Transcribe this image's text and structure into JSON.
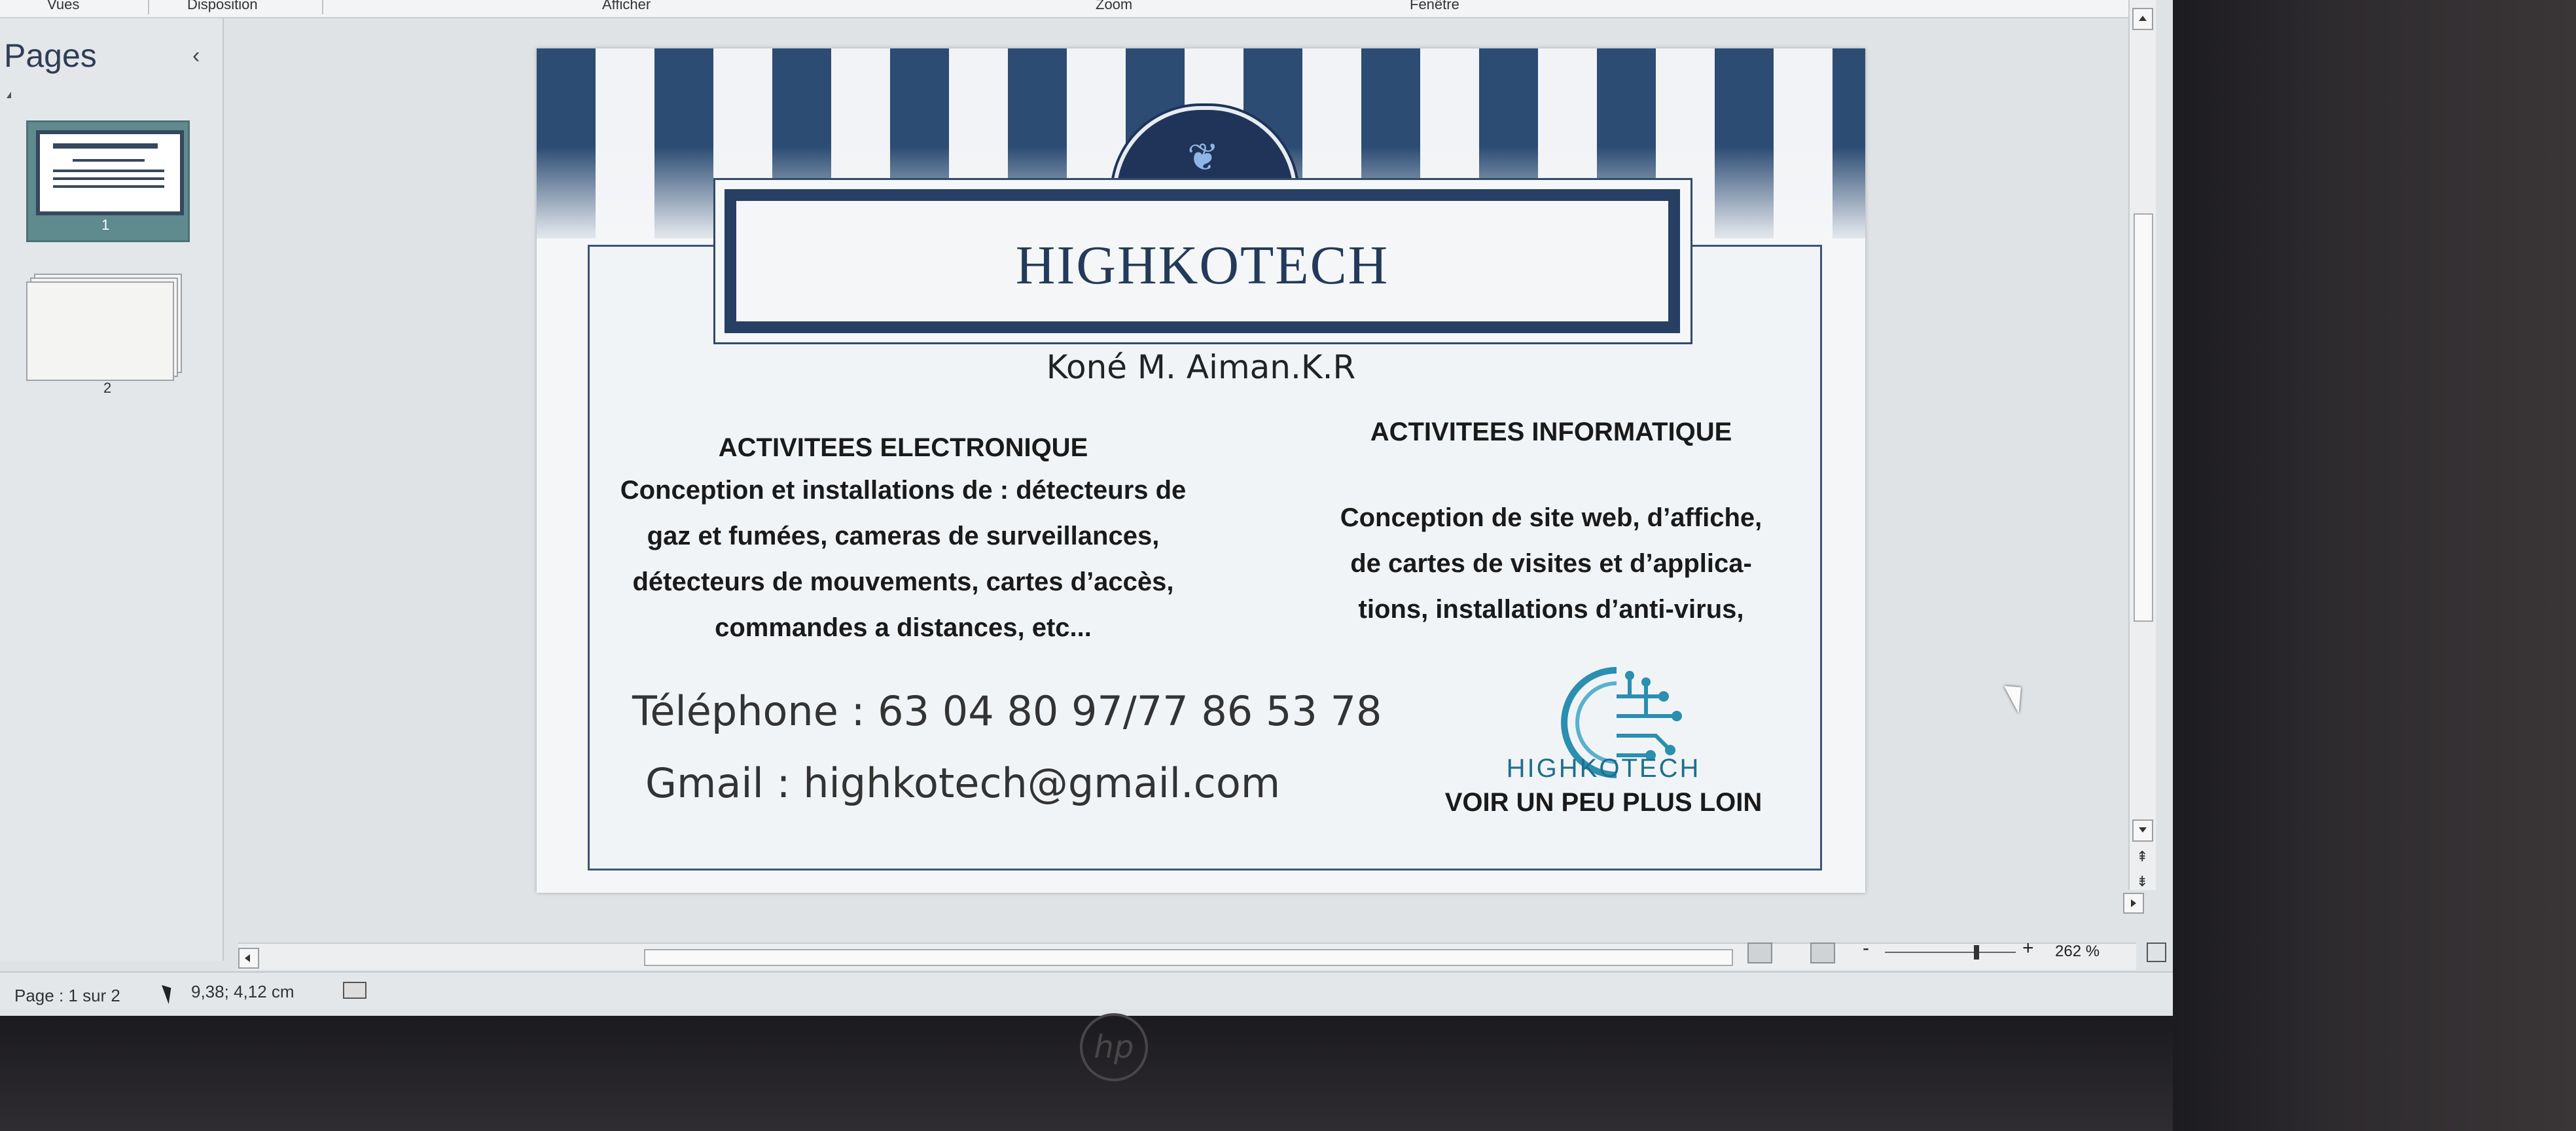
{
  "ribbon": {
    "groups": [
      "Vues",
      "Disposition",
      "Afficher",
      "Zoom",
      "Fenêtre"
    ]
  },
  "pages_panel": {
    "title": "Pages",
    "collapse_glyph": "‹",
    "thumbnails": [
      {
        "number": "1",
        "selected": true
      },
      {
        "number": "2",
        "selected": false
      }
    ]
  },
  "card": {
    "title": "HIGHKOTECH",
    "name": "Koné M. Aiman.K.R",
    "left_title": "ACTIVITEES ELECTRONIQUE",
    "left_lines": [
      "Conception et installations de : détecteurs de",
      "gaz et fumées, cameras de surveillances,",
      "détecteurs de mouvements, cartes d’accès,",
      "commandes a distances, etc..."
    ],
    "right_title": "ACTIVITEES INFORMATIQUE",
    "right_lines": [
      "Conception de site web, d’affiche,",
      "de cartes de visites et d’applica-",
      "tions, installations d’anti-virus,"
    ],
    "phone": "Téléphone :  63 04 80 97/77 86 53 78",
    "gmail": "Gmail : highkotech@gmail.com",
    "logo_name": "HIGHKOTECH",
    "slogan": "VOIR UN PEU PLUS LOIN",
    "colors": {
      "navy": "#273f63",
      "teal": "#1f6f8b"
    }
  },
  "statusbar": {
    "page": "Page : 1 sur 2",
    "coords": "9,38; 4,12  cm",
    "zoom_minus": "-",
    "zoom_plus": "+",
    "zoom_percent": "262 %",
    "zoom_level": 2.62
  },
  "icons": [
    "cursor-position-icon",
    "macro-record-icon",
    "zoom-fit-icon",
    "view-print-layout-icon",
    "view-web-icon",
    "circuit-logo-icon",
    "emblem-feather-icon",
    "hp-logo-icon"
  ]
}
